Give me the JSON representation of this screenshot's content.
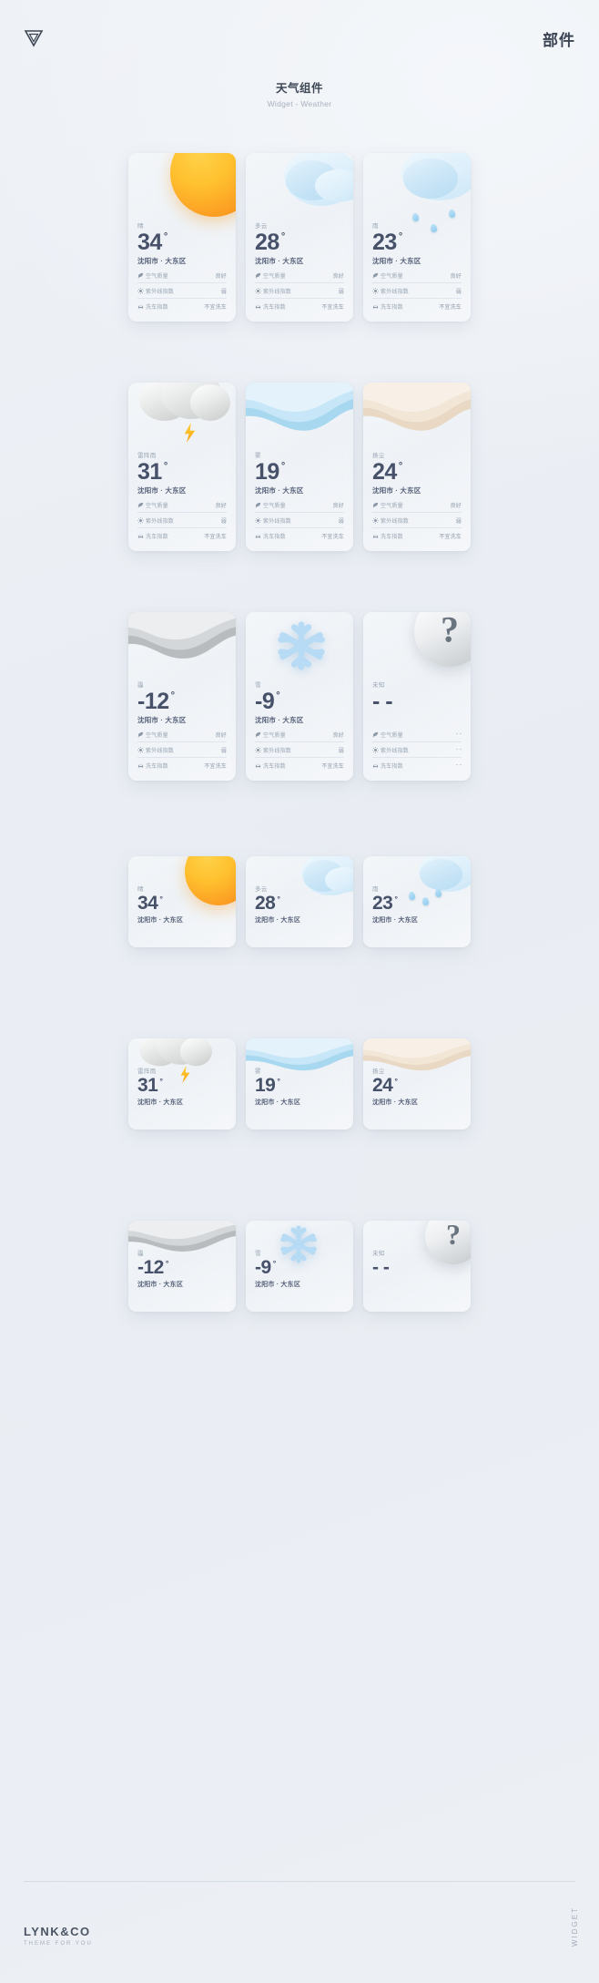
{
  "header": {
    "logo_icon": "lynkco-triangle-logo",
    "right_label": "部件",
    "title_cn": "天气组件",
    "title_en": "Widget - Weather"
  },
  "location": "沈阳市 · 大东区",
  "degree_symbol": "°",
  "detail_labels": {
    "air": "空气质量",
    "uv": "紫外线指数",
    "wash": "洗车指数"
  },
  "detail_icons": {
    "air": "leaf-icon",
    "uv": "sun-ray-icon",
    "wash": "car-icon"
  },
  "values": {
    "air_good": "良好",
    "uv_weak": "弱",
    "wash_no": "不宜洗车",
    "empty": "- -"
  },
  "rows": [
    {
      "id": "row-detailed-1",
      "cards": [
        {
          "art": "sunny",
          "cond": "晴",
          "temp": "34",
          "deg": "°",
          "loc": "沈阳市 · 大东区",
          "details": [
            {
              "icon": "leaf-icon",
              "label": "空气质量",
              "value": "良好"
            },
            {
              "icon": "sun-ray-icon",
              "label": "紫外线指数",
              "value": "弱"
            },
            {
              "icon": "car-icon",
              "label": "洗车指数",
              "value": "不宜洗车"
            }
          ]
        },
        {
          "art": "cloudy",
          "cond": "多云",
          "temp": "28",
          "deg": "°",
          "loc": "沈阳市 · 大东区",
          "details": [
            {
              "icon": "leaf-icon",
              "label": "空气质量",
              "value": "良好"
            },
            {
              "icon": "sun-ray-icon",
              "label": "紫外线指数",
              "value": "弱"
            },
            {
              "icon": "car-icon",
              "label": "洗车指数",
              "value": "不宜洗车"
            }
          ]
        },
        {
          "art": "rain",
          "cond": "雨",
          "temp": "23",
          "deg": "°",
          "loc": "沈阳市 · 大东区",
          "details": [
            {
              "icon": "leaf-icon",
              "label": "空气质量",
              "value": "良好"
            },
            {
              "icon": "sun-ray-icon",
              "label": "紫外线指数",
              "value": "弱"
            },
            {
              "icon": "car-icon",
              "label": "洗车指数",
              "value": "不宜洗车"
            }
          ]
        }
      ]
    },
    {
      "id": "row-detailed-2",
      "cards": [
        {
          "art": "thunder",
          "cond": "雷阵雨",
          "temp": "31",
          "deg": "°",
          "loc": "沈阳市 · 大东区",
          "details": [
            {
              "icon": "leaf-icon",
              "label": "空气质量",
              "value": "良好"
            },
            {
              "icon": "sun-ray-icon",
              "label": "紫外线指数",
              "value": "弱"
            },
            {
              "icon": "car-icon",
              "label": "洗车指数",
              "value": "不宜洗车"
            }
          ]
        },
        {
          "art": "fog",
          "cond": "雾",
          "temp": "19",
          "deg": "°",
          "loc": "沈阳市 · 大东区",
          "details": [
            {
              "icon": "leaf-icon",
              "label": "空气质量",
              "value": "良好"
            },
            {
              "icon": "sun-ray-icon",
              "label": "紫外线指数",
              "value": "弱"
            },
            {
              "icon": "car-icon",
              "label": "洗车指数",
              "value": "不宜洗车"
            }
          ]
        },
        {
          "art": "sand",
          "cond": "扬尘",
          "temp": "24",
          "deg": "°",
          "loc": "沈阳市 · 大东区",
          "details": [
            {
              "icon": "leaf-icon",
              "label": "空气质量",
              "value": "良好"
            },
            {
              "icon": "sun-ray-icon",
              "label": "紫外线指数",
              "value": "弱"
            },
            {
              "icon": "car-icon",
              "label": "洗车指数",
              "value": "不宜洗车"
            }
          ]
        }
      ]
    },
    {
      "id": "row-detailed-3",
      "cards": [
        {
          "art": "haze",
          "cond": "霾",
          "temp": "-12",
          "deg": "°",
          "loc": "沈阳市 · 大东区",
          "details": [
            {
              "icon": "leaf-icon",
              "label": "空气质量",
              "value": "良好"
            },
            {
              "icon": "sun-ray-icon",
              "label": "紫外线指数",
              "value": "弱"
            },
            {
              "icon": "car-icon",
              "label": "洗车指数",
              "value": "不宜洗车"
            }
          ]
        },
        {
          "art": "snow",
          "cond": "雪",
          "temp": "-9",
          "deg": "°",
          "loc": "沈阳市 · 大东区",
          "details": [
            {
              "icon": "leaf-icon",
              "label": "空气质量",
              "value": "良好"
            },
            {
              "icon": "sun-ray-icon",
              "label": "紫外线指数",
              "value": "弱"
            },
            {
              "icon": "car-icon",
              "label": "洗车指数",
              "value": "不宜洗车"
            }
          ]
        },
        {
          "art": "unknown",
          "cond": "未知",
          "temp": "- -",
          "deg": "",
          "loc": "",
          "details": [
            {
              "icon": "leaf-icon",
              "label": "空气质量",
              "value": "- -"
            },
            {
              "icon": "sun-ray-icon",
              "label": "紫外线指数",
              "value": "- -"
            },
            {
              "icon": "car-icon",
              "label": "洗车指数",
              "value": "- -"
            }
          ]
        }
      ]
    },
    {
      "id": "row-compact-1",
      "cards": [
        {
          "art": "sunny",
          "cond": "晴",
          "temp": "34",
          "deg": "°",
          "loc": "沈阳市 · 大东区"
        },
        {
          "art": "cloudy",
          "cond": "多云",
          "temp": "28",
          "deg": "°",
          "loc": "沈阳市 · 大东区"
        },
        {
          "art": "rain",
          "cond": "雨",
          "temp": "23",
          "deg": "°",
          "loc": "沈阳市 · 大东区"
        }
      ]
    },
    {
      "id": "row-compact-2",
      "cards": [
        {
          "art": "thunder",
          "cond": "雷阵雨",
          "temp": "31",
          "deg": "°",
          "loc": "沈阳市 · 大东区"
        },
        {
          "art": "fog",
          "cond": "雾",
          "temp": "19",
          "deg": "°",
          "loc": "沈阳市 · 大东区"
        },
        {
          "art": "sand",
          "cond": "扬尘",
          "temp": "24",
          "deg": "°",
          "loc": "沈阳市 · 大东区"
        }
      ]
    },
    {
      "id": "row-compact-3",
      "cards": [
        {
          "art": "haze",
          "cond": "霾",
          "temp": "-12",
          "deg": "°",
          "loc": "沈阳市 · 大东区"
        },
        {
          "art": "snow",
          "cond": "雪",
          "temp": "-9",
          "deg": "°",
          "loc": "沈阳市 · 大东区"
        },
        {
          "art": "unknown",
          "cond": "未知",
          "temp": "- -",
          "deg": "",
          "loc": ""
        }
      ]
    }
  ],
  "footer": {
    "brand": "LYNK&CO",
    "tagline": "THEME FOR YOU",
    "vertical_label": "WIDGET"
  },
  "colors": {
    "page_bg": "#eef1f5",
    "card_bg": "#f1f5f8",
    "temp_text": "#47526a",
    "muted_text": "#9aa5b4",
    "sun_orange": "#fba02a",
    "cloud_blue": "#bcdef4",
    "bolt_yellow": "#fcb81e"
  }
}
